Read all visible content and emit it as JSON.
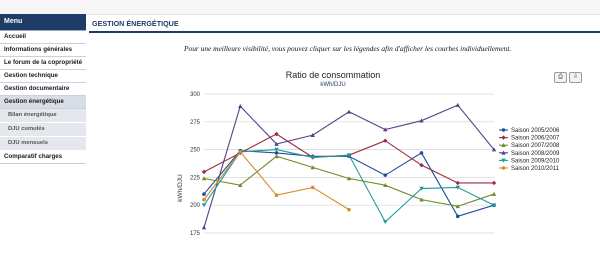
{
  "sidebar": {
    "header": "Menu",
    "items": [
      {
        "label": "Accueil"
      },
      {
        "label": "Informations générales"
      },
      {
        "label": "Le forum de la copropriété"
      },
      {
        "label": "Gestion technique"
      },
      {
        "label": "Gestion documentaire"
      },
      {
        "label": "Gestion énergétique"
      }
    ],
    "subitems": [
      {
        "label": "Bilan énergétique"
      },
      {
        "label": "DJU cumulés"
      },
      {
        "label": "DJU mensuels"
      }
    ],
    "after": {
      "label": "Comparatif charges"
    }
  },
  "page": {
    "title": "Gestion énergétique",
    "intro": "Pour une meilleure visibilité, vous pouvez cliquer sur les légendes afin d'afficher les courbes individuellement."
  },
  "toolbar": {
    "print_icon": "print-icon",
    "export_icon": "download-icon"
  },
  "chart_data": {
    "type": "line",
    "title": "Ratio de consommation",
    "subtitle": "kWh/DJU",
    "ylabel": "kWh/DJU",
    "xlabel": "",
    "ylim": [
      175,
      300
    ],
    "yticks": [
      175,
      200,
      225,
      250,
      275,
      300
    ],
    "grid": true,
    "legend_position": "right",
    "series": [
      {
        "name": "Saison 2005/2006",
        "color": "#1f4e9c",
        "marker": "circle",
        "values": [
          210,
          249,
          247,
          244,
          244,
          227,
          247,
          190,
          200
        ]
      },
      {
        "name": "Saison 2006/2007",
        "color": "#9c2a3c",
        "marker": "diamond",
        "values": [
          230,
          247,
          264,
          243,
          245,
          258,
          236,
          220,
          220
        ]
      },
      {
        "name": "Saison 2007/2008",
        "color": "#6e8c2a",
        "marker": "triangle",
        "values": [
          224,
          218,
          244,
          234,
          224,
          218,
          205,
          199,
          210
        ]
      },
      {
        "name": "Saison 2008/2009",
        "color": "#5b3f86",
        "marker": "triangle",
        "values": [
          180,
          289,
          255,
          263,
          284,
          268,
          276,
          290,
          250
        ]
      },
      {
        "name": "Saison 2009/2010",
        "color": "#1e9a9a",
        "marker": "triangle-down",
        "values": [
          200,
          248,
          250,
          243,
          245,
          185,
          215,
          216,
          200
        ]
      },
      {
        "name": "Saison 2010/2011",
        "color": "#d98a2a",
        "marker": "circle",
        "values": [
          205,
          248,
          209,
          216,
          196
        ]
      }
    ]
  }
}
